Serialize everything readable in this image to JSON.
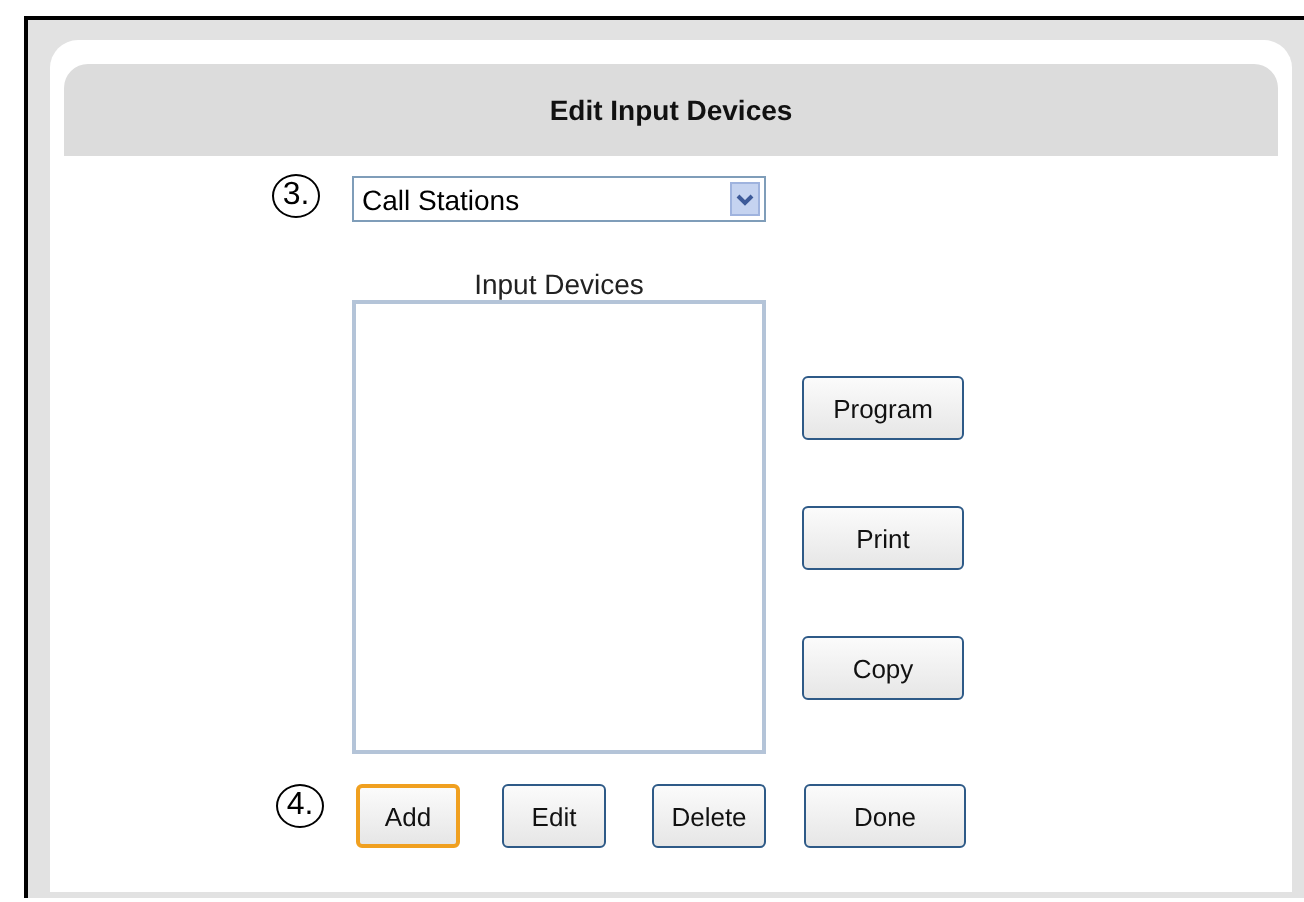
{
  "title": "Edit Input Devices",
  "step_markers": [
    "3.",
    "4."
  ],
  "device_type": {
    "value": "Call Stations"
  },
  "list_label": "Input Devices",
  "side_buttons": [
    {
      "label": "Program",
      "focused": false
    },
    {
      "label": "Print",
      "focused": false
    },
    {
      "label": "Copy",
      "focused": false
    }
  ],
  "bottom_buttons": [
    {
      "label": "Add",
      "focused": true
    },
    {
      "label": "Edit",
      "focused": false
    },
    {
      "label": "Delete",
      "focused": false
    },
    {
      "label": "Done",
      "focused": false
    }
  ]
}
